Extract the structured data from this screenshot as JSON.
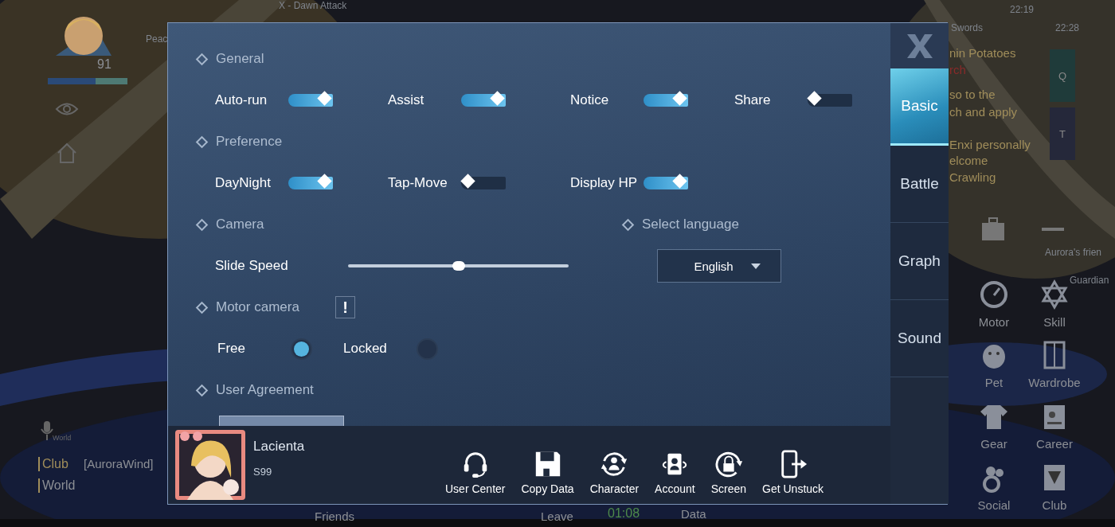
{
  "hud": {
    "quest_title": "X - Dawn Attack",
    "level": "91",
    "buff": "Peac",
    "clock": "22:19",
    "chat_header": [
      "Swords",
      "22:28"
    ],
    "chat_lines": [
      {
        "text": "nin Potatoes",
        "kind": "name"
      },
      {
        "text": "rch",
        "kind": "alert"
      },
      {
        "text": "so to the",
        "kind": "msg"
      },
      {
        "text": "ch and apply",
        "kind": "msg"
      },
      {
        "text": "Enxi personally",
        "kind": "msg"
      },
      {
        "text": "elcome",
        "kind": "msg"
      },
      {
        "text": "Crawling",
        "kind": "msg"
      }
    ],
    "quick_keys": [
      "Q",
      "T"
    ],
    "side_labels": [
      "Aurora's frien",
      "Guardian"
    ],
    "menu": [
      {
        "label": "Motor",
        "kind": "gauge"
      },
      {
        "label": "Skill",
        "kind": "star"
      },
      {
        "label": "Pet",
        "kind": "egg"
      },
      {
        "label": "Wardrobe",
        "kind": "wardrobe"
      },
      {
        "label": "Gear",
        "kind": "shirt"
      },
      {
        "label": "Career",
        "kind": "card"
      },
      {
        "label": "Social",
        "kind": "people"
      },
      {
        "label": "Club",
        "kind": "club"
      }
    ],
    "mic_label": "World",
    "chat_channels": [
      {
        "label": "Club",
        "value": "[AuroraWind]"
      },
      {
        "label": "World"
      }
    ],
    "bottom": [
      {
        "text": "Friends",
        "kind": "plain"
      },
      {
        "text": "Leave",
        "kind": "plain"
      },
      {
        "text": "01:08",
        "kind": "timer"
      },
      {
        "text": "Data",
        "kind": "stat"
      }
    ]
  },
  "sections": [
    {
      "kind": "toggles",
      "title": "General",
      "items": [
        {
          "label": "Auto-run",
          "on": true
        },
        {
          "label": "Assist",
          "on": true
        },
        {
          "label": "Notice",
          "on": true
        },
        {
          "label": "Share",
          "on": false
        }
      ]
    },
    {
      "kind": "toggles",
      "title": "Preference",
      "items": [
        {
          "label": "DayNight",
          "on": true
        },
        {
          "label": "Tap-Move",
          "on": false
        },
        {
          "label": "Display HP",
          "on": true
        }
      ]
    },
    {
      "kind": "camera",
      "title": "Camera",
      "slider": {
        "label": "Slide Speed",
        "level": 0.5
      },
      "language": {
        "title": "Select language",
        "value": "English"
      }
    },
    {
      "kind": "radio",
      "title": "Motor camera",
      "info": "!",
      "options": [
        {
          "label": "Free",
          "selected": true
        },
        {
          "label": "Locked",
          "selected": false
        }
      ]
    },
    {
      "kind": "agreement",
      "title": "User Agreement"
    }
  ],
  "tabs": [
    {
      "label": "Basic",
      "selected": true
    },
    {
      "label": "Battle",
      "selected": false
    },
    {
      "label": "Graph",
      "selected": false
    },
    {
      "label": "Sound",
      "selected": false
    }
  ],
  "profile": {
    "name": "Lacienta",
    "server": "S99"
  },
  "actions": [
    {
      "label": "User Center",
      "kind": "headset"
    },
    {
      "label": "Copy Data",
      "kind": "floppy"
    },
    {
      "label": "Character",
      "kind": "person-cycle"
    },
    {
      "label": "Account",
      "kind": "account"
    },
    {
      "label": "Screen",
      "kind": "lock-cycle"
    },
    {
      "label": "Get Unstuck",
      "kind": "phone-exit"
    }
  ]
}
